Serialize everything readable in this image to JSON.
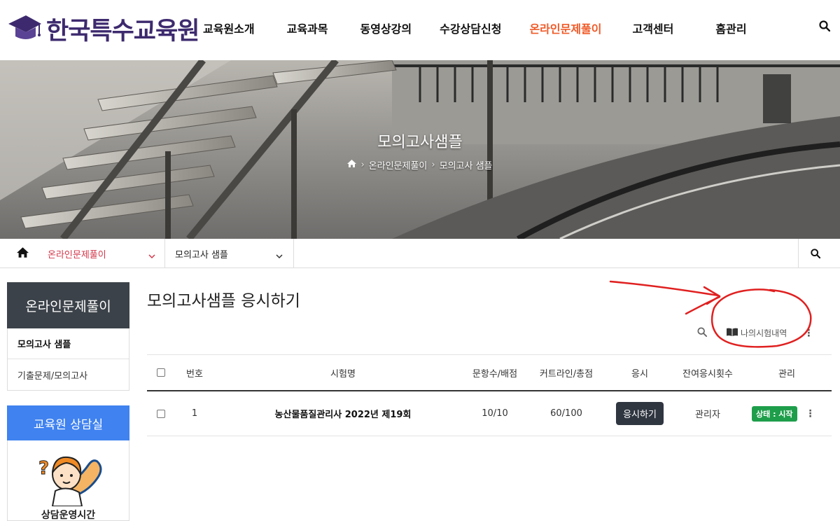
{
  "header": {
    "logo_text": "한국특수교육원",
    "nav": [
      {
        "label": "교육원소개"
      },
      {
        "label": "교육과목"
      },
      {
        "label": "동영상강의"
      },
      {
        "label": "수강상담신청"
      },
      {
        "label": "온라인문제풀이",
        "active": true
      },
      {
        "label": "고객센터"
      },
      {
        "label": "홈관리"
      }
    ]
  },
  "hero": {
    "title": "모의고사샘플",
    "breadcrumb": [
      "온라인문제풀이",
      "모의고사 샘플"
    ]
  },
  "subnav": {
    "category": "온라인문제풀이",
    "page": "모의고사 샘플"
  },
  "sidebar": {
    "title": "온라인문제풀이",
    "items": [
      {
        "label": "모의고사 샘플",
        "active": true
      },
      {
        "label": "기출문제/모의고사"
      }
    ],
    "consult_title": "교육원 상담실",
    "consult_caption": "상담운영시간"
  },
  "main": {
    "title": "모의고사샘플 응시하기",
    "history_label": "나의시험내역",
    "columns": [
      "번호",
      "시험명",
      "문항수/배점",
      "커트라인/총점",
      "응시",
      "잔여응시횟수",
      "관리"
    ],
    "rows": [
      {
        "no": "1",
        "name": "농산물품질관리사 2022년 제19회",
        "questions": "10/10",
        "cutline": "60/100",
        "action": "응시하기",
        "remaining": "관리자",
        "status": "상태 : 시작"
      }
    ]
  },
  "colors": {
    "brand": "#3d2a6e",
    "nav_active": "#f05a28",
    "subnav_active": "#d2374a",
    "sidebar_head": "#3c4249",
    "consult_head": "#3f82f0",
    "status_badge": "#1e9e4a",
    "annotation": "#e02020"
  }
}
